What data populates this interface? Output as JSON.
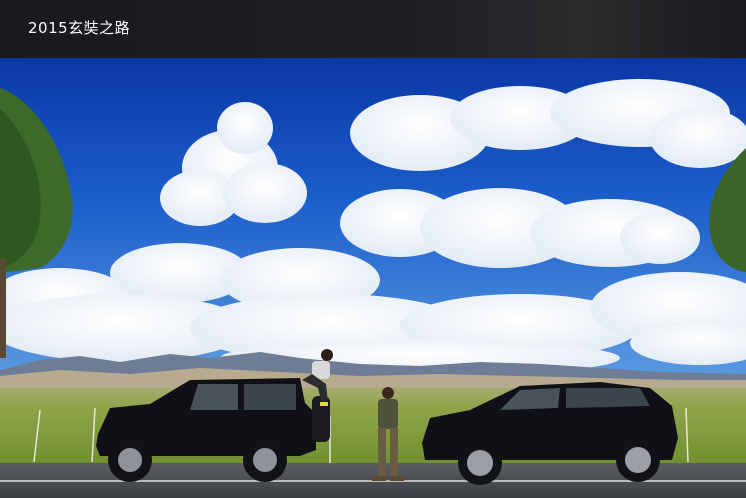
{
  "header": {
    "title": "2015玄奘之路"
  },
  "photo": {
    "description_icon": "landscape-photo",
    "colors": {
      "sky_top": "#0b3fb0",
      "sky_bottom": "#3f86de",
      "cloud": "#ffffff",
      "field": "#7f9a3a",
      "road": "#4a4d52",
      "vehicle": "#0f1116"
    }
  }
}
